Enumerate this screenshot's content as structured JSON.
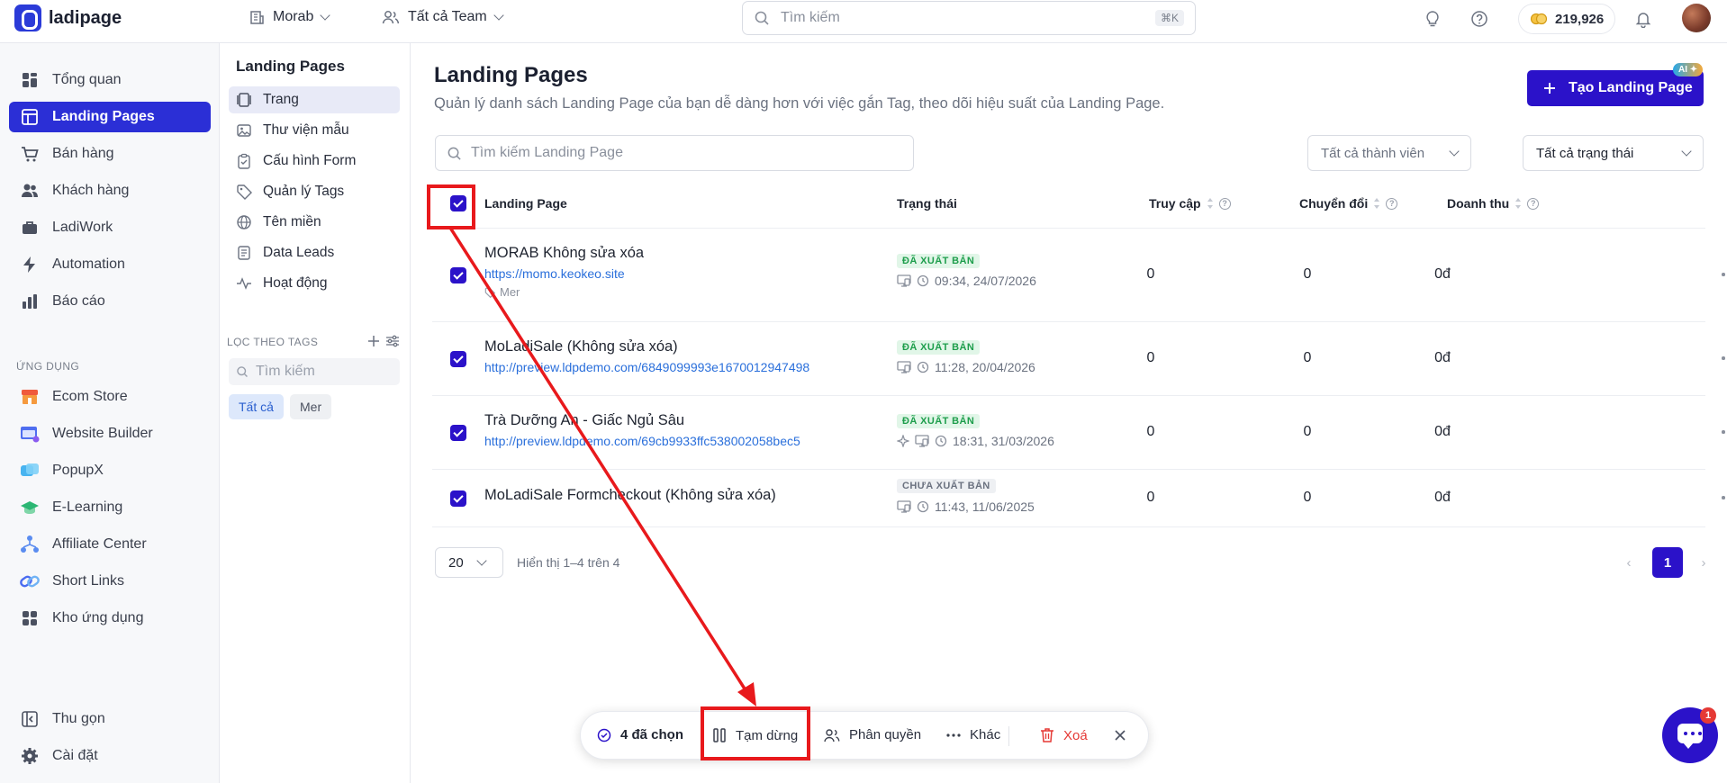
{
  "topbar": {
    "logo_text": "ladipage",
    "workspace": "Morab",
    "team": "Tất cả Team",
    "search_placeholder": "Tìm kiếm",
    "shortcut": "⌘K",
    "credits": "219,926"
  },
  "sidebar": {
    "items": [
      {
        "label": "Tổng quan",
        "icon": "dashboard-icon"
      },
      {
        "label": "Landing Pages",
        "icon": "layout-icon"
      },
      {
        "label": "Bán hàng",
        "icon": "cart-icon"
      },
      {
        "label": "Khách hàng",
        "icon": "users-icon"
      },
      {
        "label": "LadiWork",
        "icon": "briefcase-icon"
      },
      {
        "label": "Automation",
        "icon": "bolt-icon"
      },
      {
        "label": "Báo cáo",
        "icon": "bar-chart-icon"
      }
    ],
    "apps_label": "ỨNG DỤNG",
    "apps": [
      {
        "label": "Ecom Store",
        "icon": "store-icon"
      },
      {
        "label": "Website Builder",
        "icon": "website-icon"
      },
      {
        "label": "PopupX",
        "icon": "popup-icon"
      },
      {
        "label": "E-Learning",
        "icon": "graduation-icon"
      },
      {
        "label": "Affiliate Center",
        "icon": "affiliate-icon"
      },
      {
        "label": "Short Links",
        "icon": "link-icon"
      },
      {
        "label": "Kho ứng dụng",
        "icon": "apps-grid-icon"
      }
    ],
    "collapse": "Thu gọn",
    "settings": "Cài đặt"
  },
  "subnav": {
    "title": "Landing Pages",
    "items": [
      {
        "label": "Trang"
      },
      {
        "label": "Thư viện mẫu"
      },
      {
        "label": "Cấu hình Form"
      },
      {
        "label": "Quản lý Tags"
      },
      {
        "label": "Tên miền"
      },
      {
        "label": "Data Leads"
      },
      {
        "label": "Hoạt động"
      }
    ],
    "tags_label": "LỌC THEO TAGS",
    "tag_search_placeholder": "Tìm kiếm",
    "chips": [
      "Tất cả",
      "Mer"
    ]
  },
  "main": {
    "title": "Landing Pages",
    "description": "Quản lý danh sách Landing Page của bạn dễ dàng hơn với việc gắn Tag, theo dõi hiệu suất của Landing Page.",
    "create_button": "Tạo Landing Page",
    "ai_badge": "AI",
    "search_placeholder": "Tìm kiếm Landing Page",
    "member_filter": "Tất cả thành viên",
    "status_filter": "Tất cả trạng thái",
    "columns": {
      "name": "Landing Page",
      "status": "Trạng thái",
      "visits": "Truy cập",
      "conversions": "Chuyển đổi",
      "revenue": "Doanh thu"
    },
    "rows": [
      {
        "name": "MORAB Không sửa xóa",
        "url": "https://momo.keokeo.site",
        "tag": "Mer",
        "status": "ĐÃ XUẤT BẢN",
        "time": "09:34, 24/07/2026",
        "visits": "0",
        "conversions": "0",
        "revenue": "0đ"
      },
      {
        "name": "MoLadiSale (Không sửa xóa)",
        "url": "http://preview.ldpdemo.com/6849099993e1670012947498",
        "status": "ĐÃ XUẤT BẢN",
        "time": "11:28, 20/04/2026",
        "visits": "0",
        "conversions": "0",
        "revenue": "0đ"
      },
      {
        "name": "Trà Dưỡng An - Giấc Ngủ Sâu",
        "url": "http://preview.ldpdemo.com/69cb9933ffc538002058bec5",
        "status": "ĐÃ XUẤT BẢN",
        "time": "18:31, 31/03/2026",
        "visits": "0",
        "conversions": "0",
        "revenue": "0đ"
      },
      {
        "name": "MoLadiSale Formcheckout (Không sửa xóa)",
        "status": "CHƯA XUẤT BẢN",
        "time": "11:43, 11/06/2025",
        "visits": "0",
        "conversions": "0",
        "revenue": "0đ"
      }
    ],
    "page_size": "20",
    "page_info": "Hiển thị 1–4 trên 4",
    "current_page": "1"
  },
  "action_bar": {
    "selected": "4 đã chọn",
    "pause": "Tạm dừng",
    "permission": "Phân quyền",
    "other": "Khác",
    "delete": "Xoá"
  },
  "chat": {
    "count": "1"
  },
  "colors": {
    "accent": "#2b12c9",
    "annotation": "#e8191c",
    "published": "#1e9e4c"
  }
}
